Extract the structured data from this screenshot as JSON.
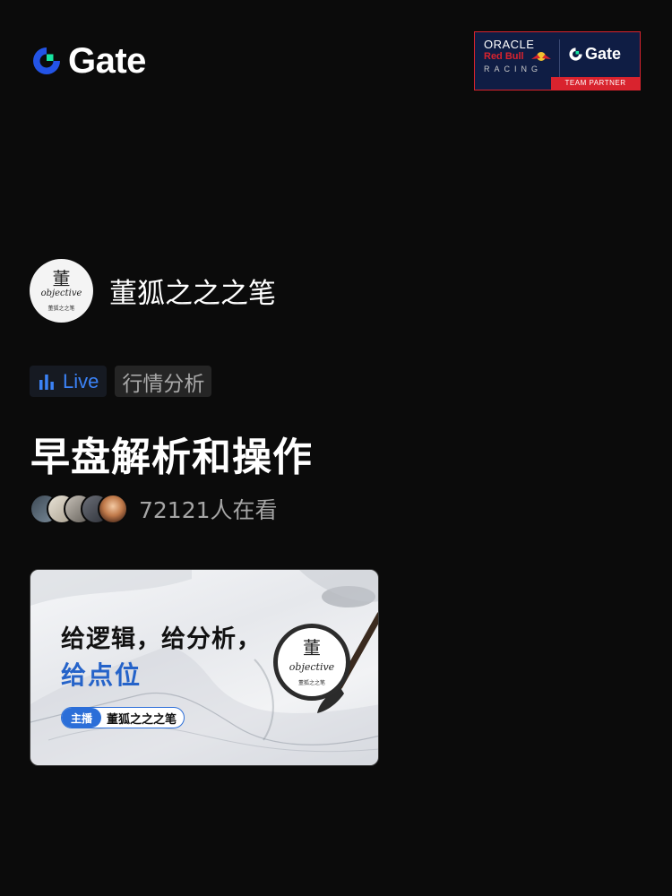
{
  "brand": {
    "name": "Gate",
    "accent": "#2354E6",
    "accent2": "#17E6A1"
  },
  "partner": {
    "line1": "ORACLE",
    "line2": "Red Bull",
    "line3": "RACING",
    "brand": "Gate",
    "badge": "TEAM PARTNER"
  },
  "host": {
    "avatar": {
      "top": "董",
      "middle": "objective",
      "bottom": "董狐之之笔"
    },
    "name": "董狐之之之笔"
  },
  "tags": {
    "live": "Live",
    "category": "行情分析"
  },
  "stream": {
    "title": "早盘解析和操作",
    "viewers": "72121人在看"
  },
  "cover": {
    "headline1": "给逻辑，给分析，",
    "headline2": "给点位",
    "host_label": "主播",
    "host_name": "董狐之之之笔",
    "seal": {
      "top": "董",
      "middle": "objective",
      "bottom": "董狐之之笔"
    }
  }
}
